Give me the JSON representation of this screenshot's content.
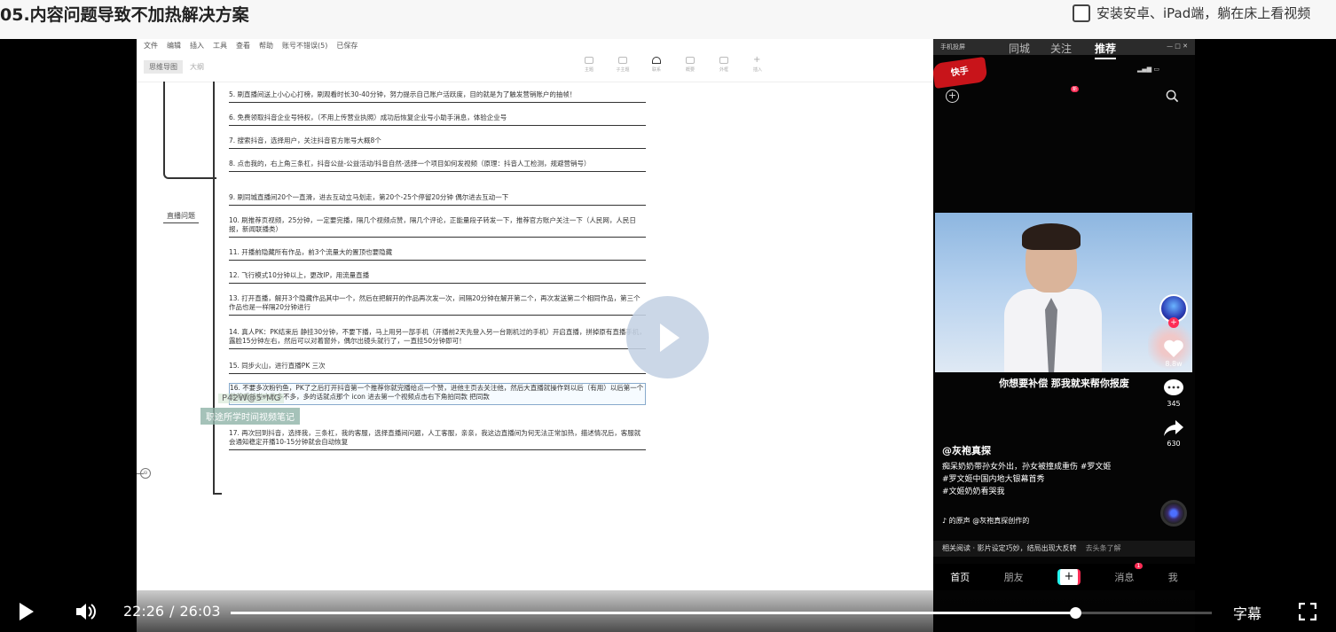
{
  "page": {
    "title": "05.内容问题导致不加热解决方案",
    "install_label": "安装安卓、iPad端，躺在床上看视频"
  },
  "slide": {
    "menu": [
      "文件",
      "编辑",
      "插入",
      "工具",
      "查看",
      "帮助",
      "账号不错误(5)",
      "已保存"
    ],
    "subtabs": {
      "active": "思维导图",
      "inactive": "大纲"
    },
    "tools": [
      "主题",
      "子主题",
      "联系",
      "概要",
      "外框",
      "插入"
    ],
    "branch_label": "直播问题",
    "end_node": "⊖",
    "items": [
      "5. 刷直播间送上小心心打榜，刷观看时长30-40分钟，努力提示自己账户活跃度，目的就是为了触发营销账户的抽帧！",
      "6. 免费领取抖音企业号特权，（不用上传营业执照）成功后恢复企业号小助手消息，体验企业号",
      "7. 搜索抖音，选择用户，关注抖音官方账号大概8个",
      "8. 点击我的，右上角三条杠，抖音公益-公益活动/抖音自然-选择一个项目如何发视频（原理：抖音人工检测，规避营销号）",
      "9. 刷同城直播间20个一直滑，进去互动立马划走，第20个-25个停留20分钟 偶尔进去互动一下",
      "10. 刷推荐页视频，25分钟，一定要完播，隔几个视频点赞，隔几个评论，正能量段子转发一下，推荐官方账户关注一下（人民网，人民日报，新闻联播类）",
      "11. 开播前隐藏所有作品，前3个流量大的置顶也要隐藏",
      "12. 飞行模式10分钟以上，更改IP，用流量直播",
      "13. 打开直播，解开3个隐藏作品其中一个，然后在把解开的作品再次发一次，间隔20分钟在解开第二个，再次发送第二个相同作品，第三个作品也是一样隔20分钟进行",
      "14. 真人PK：PK结束后 静挂30分钟，不要下播，马上用另一部手机（开播前2天先登入另一台刚机过的手机）开启直播，拼掉原有直播手机，露脸15分钟左右，然后可以对着窗外，偶尔出镜头就行了，一直挂50分钟即可！",
      "15. 同步火山，进行直播PK 三次",
      "16. 不要多次粉钓鱼，PK了之后打开抖音第一个推荐你就完播给点一个赞，进他主页去关注他，然后大直播就操作到以后（有用）以后第一个推荐看转发人数多不多，多的话就点那个 icon 进去第一个视频点击右下角拍同款 把同款",
      "17. 再次回到抖音，选择我，三条杠，我的客服，选择直播间问题，人工客服，亲亲，我这边直播间为何无法正常加热，描述情况后，客服就会通知稳定开播10-15分钟就会自动恢复"
    ],
    "overlay_top": "P42W@5*MG",
    "overlay_bottom": "职途所学时间视频笔记"
  },
  "phone": {
    "window_title": "手机投屏",
    "window_controls": "— □ ✕",
    "tabs": [
      "同城",
      "关注",
      "推荐"
    ],
    "follow_badge": "新",
    "active_tab": "推荐",
    "brand": "快手",
    "video_subtitle": "你想要补偿 那我就来帮你报废",
    "likes": "8.8w",
    "comments": "345",
    "shares": "630",
    "author": "@灰袍真探",
    "description": "痴呆奶奶带孙女外出，孙女被撞成重伤 #罗文姬",
    "hashtag1": "#罗文姬中国内地大银幕首秀",
    "hashtag2": "#文姬奶奶看哭我",
    "music": "♪ 的原声  @灰袍真探创作的",
    "related": "相关阅读 · 影片设定巧妙，结局出现大反转",
    "related_more": "去头条了解",
    "nav": [
      "首页",
      "朋友",
      "+",
      "消息",
      "我"
    ],
    "msg_badge": "1"
  },
  "player": {
    "current_time": "22:26",
    "total_time": "26:03",
    "progress_fraction": 0.861,
    "subtitle_label": "字幕"
  },
  "colors": {
    "accent_red": "#fe2c55",
    "accent_cyan": "#25f4ee",
    "play_overlay": "#c4d2e4"
  },
  "icons": [
    "checkbox-icon",
    "play-icon",
    "volume-icon",
    "fullscreen-icon",
    "search-icon",
    "heart-icon",
    "comment-icon",
    "share-icon",
    "plus-icon"
  ]
}
